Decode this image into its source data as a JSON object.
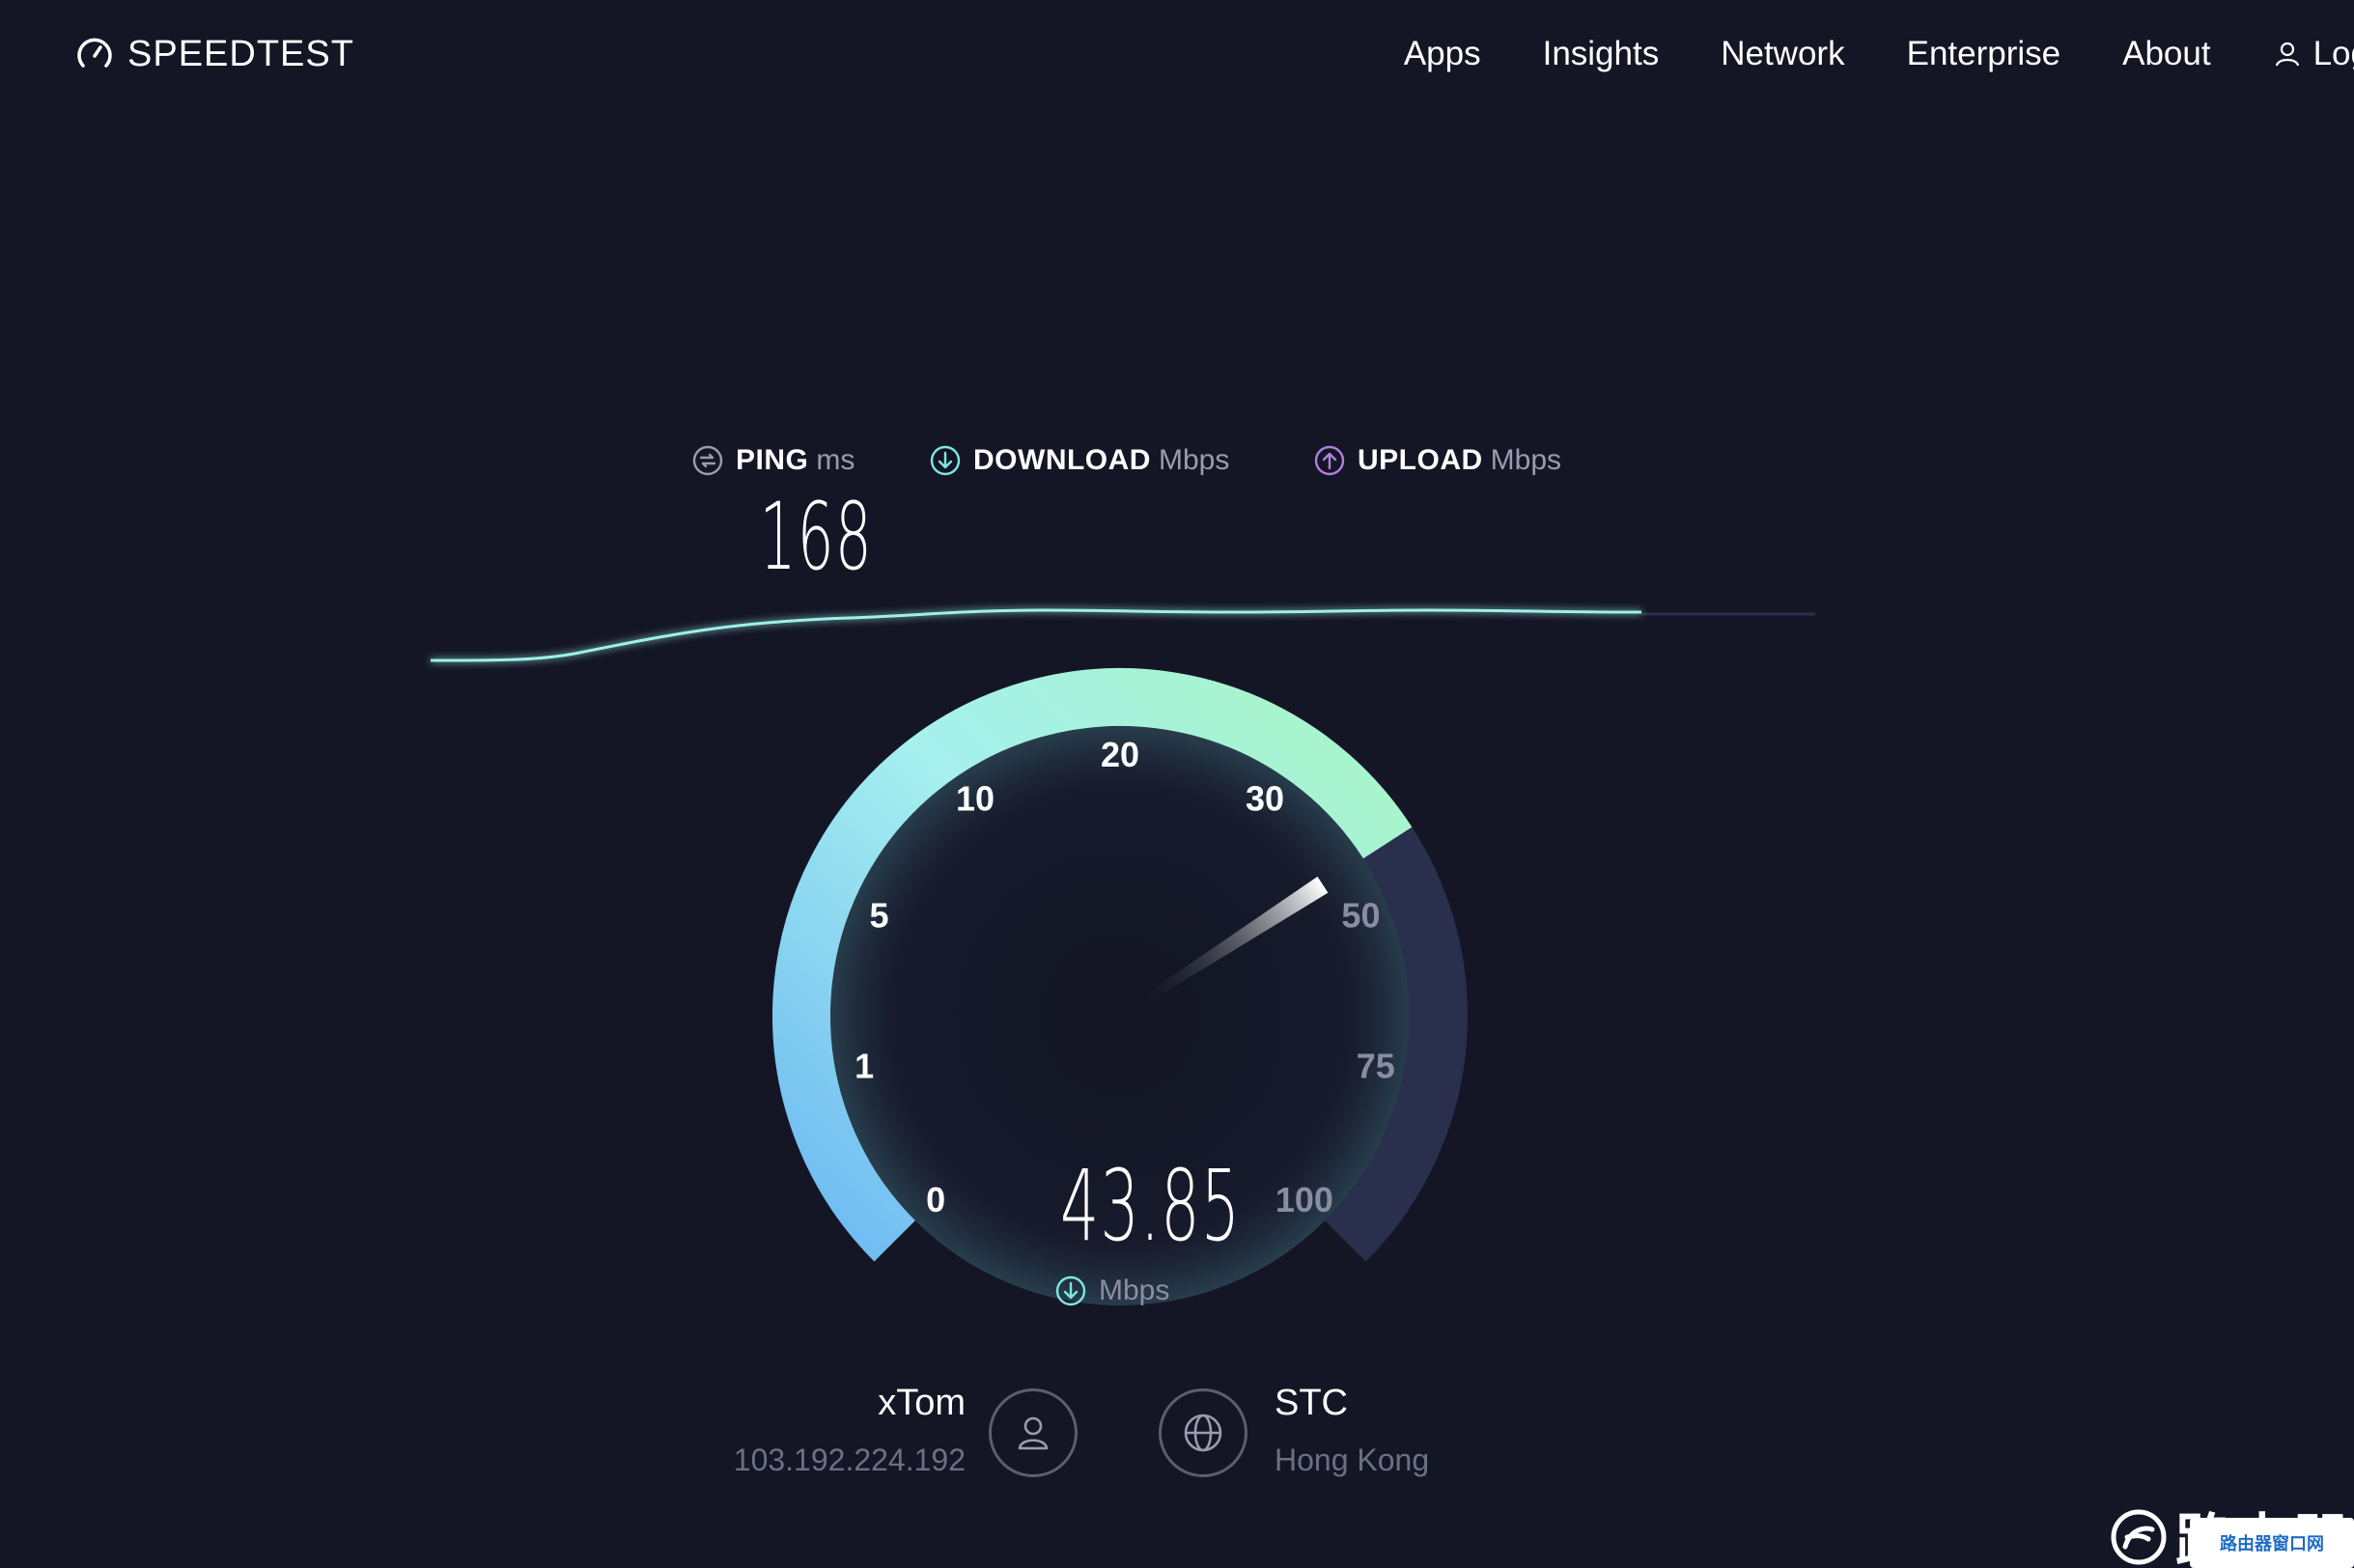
{
  "header": {
    "logo_text": "SPEEDTEST",
    "nav": [
      "Apps",
      "Insights",
      "Network",
      "Enterprise",
      "About"
    ],
    "login_label": "Log"
  },
  "stats": {
    "ping": {
      "label": "PING",
      "unit": "ms",
      "value": "168",
      "icon": "ping-icon"
    },
    "download": {
      "label": "DOWNLOAD",
      "unit": "Mbps",
      "icon": "download-arrow-icon"
    },
    "upload": {
      "label": "UPLOAD",
      "unit": "Mbps",
      "icon": "upload-arrow-icon"
    }
  },
  "gauge": {
    "value": "43.85",
    "unit": "Mbps",
    "reading_mbps": 43.85,
    "scale_labels": [
      "0",
      "1",
      "5",
      "10",
      "20",
      "30",
      "50",
      "75",
      "100"
    ],
    "active_labels_count": 6
  },
  "connection": {
    "isp_name": "xTom",
    "isp_ip": "103.192.224.192",
    "server_name": "STC",
    "server_location": "Hong Kong"
  },
  "watermark": {
    "text": "路由器",
    "badge": "路由器窗口网"
  },
  "colors": {
    "background": "#141625",
    "accent_cyan": "#7ee6e0",
    "accent_green": "#a8f5c4",
    "accent_blue": "#6cb8f2",
    "upload_purple": "#b07ee0",
    "inactive_arc": "#2a2f4d"
  }
}
